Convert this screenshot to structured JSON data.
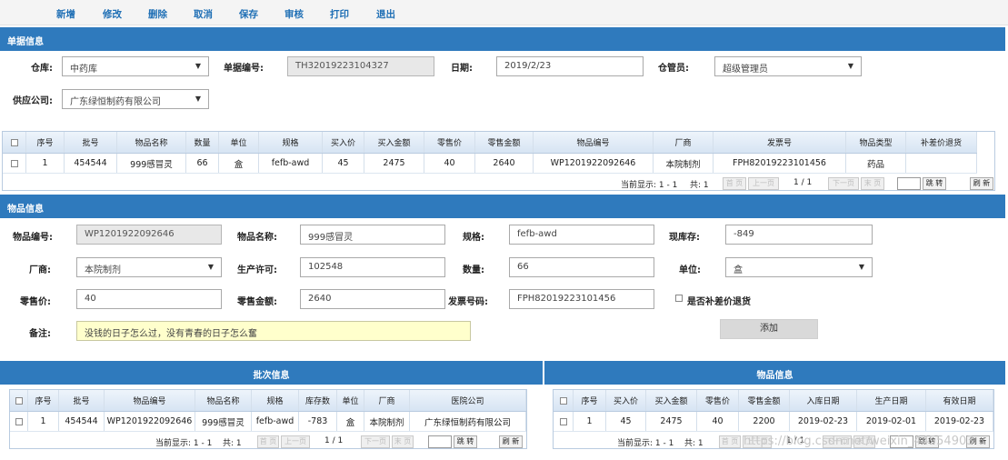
{
  "toolbar": [
    "新增",
    "修改",
    "删除",
    "取消",
    "保存",
    "审核",
    "打印",
    "退出"
  ],
  "doc": {
    "title": "单据信息",
    "warehouse_label": "仓库:",
    "warehouse_value": "中药库",
    "docno_label": "单据编号:",
    "docno_value": "TH32019223104327",
    "date_label": "日期:",
    "date_value": "2019/2/23",
    "keeper_label": "仓管员:",
    "keeper_value": "超级管理员",
    "supplier_label": "供应公司:",
    "supplier_value": "广东绿恒制药有限公司"
  },
  "main_grid": {
    "headers": [
      "序号",
      "批号",
      "物品名称",
      "数量",
      "单位",
      "规格",
      "买入价",
      "买入金额",
      "零售价",
      "零售金额",
      "物品编号",
      "厂商",
      "发票号",
      "物品类型",
      "补差价退货"
    ],
    "rows": [
      [
        "1",
        "454544",
        "999感冒灵",
        "66",
        "盒",
        "fefb-awd",
        "45",
        "2475",
        "40",
        "2640",
        "WP1201922092646",
        "本院制剂",
        "FPH82019223101456",
        "药品",
        ""
      ]
    ]
  },
  "pager": {
    "display": "当前显示: 1 - 1",
    "total": "共: 1",
    "first": "首 页",
    "prev": "上一页",
    "pages": "1 / 1",
    "next": "下一页",
    "last": "末 页",
    "jump": "跳 转",
    "refresh": "刷 新"
  },
  "item": {
    "title": "物品信息",
    "code_label": "物品编号:",
    "code_value": "WP1201922092646",
    "name_label": "物品名称:",
    "name_value": "999感冒灵",
    "spec_label": "规格:",
    "spec_value": "fefb-awd",
    "stock_label": "现库存:",
    "stock_value": "-849",
    "maker_label": "厂商:",
    "maker_value": "本院制剂",
    "license_label": "生产许可:",
    "license_value": "102548",
    "qty_label": "数量:",
    "qty_value": "66",
    "unit_label": "单位:",
    "unit_value": "盒",
    "retail_label": "零售价:",
    "retail_value": "40",
    "retail_amt_label": "零售金额:",
    "retail_amt_value": "2640",
    "invoice_label": "发票号码:",
    "invoice_value": "FPH82019223101456",
    "diff_label": "是否补差价退货",
    "note_label": "备注:",
    "note_value": "没钱的日子怎么过，没有青春的日子怎么奮",
    "add_button": "添加"
  },
  "batch": {
    "title": "批次信息",
    "headers": [
      "序号",
      "批号",
      "物品编号",
      "物品名称",
      "规格",
      "库存数",
      "单位",
      "厂商",
      "医院公司"
    ],
    "rows": [
      [
        "1",
        "454544",
        "WP1201922092646",
        "999感冒灵",
        "fefb-awd",
        "-783",
        "盒",
        "本院制剂",
        "广东绿恒制药有限公司"
      ]
    ]
  },
  "goods": {
    "title": "物品信息",
    "headers": [
      "序号",
      "买入价",
      "买入金额",
      "零售价",
      "零售金额",
      "入库日期",
      "生产日期",
      "有效日期"
    ],
    "rows": [
      [
        "1",
        "45",
        "2475",
        "40",
        "2200",
        "2019-02-23",
        "2019-02-01",
        "2019-02-23"
      ]
    ]
  },
  "watermark": "https://blog.csdn.net/weixin_44554903"
}
